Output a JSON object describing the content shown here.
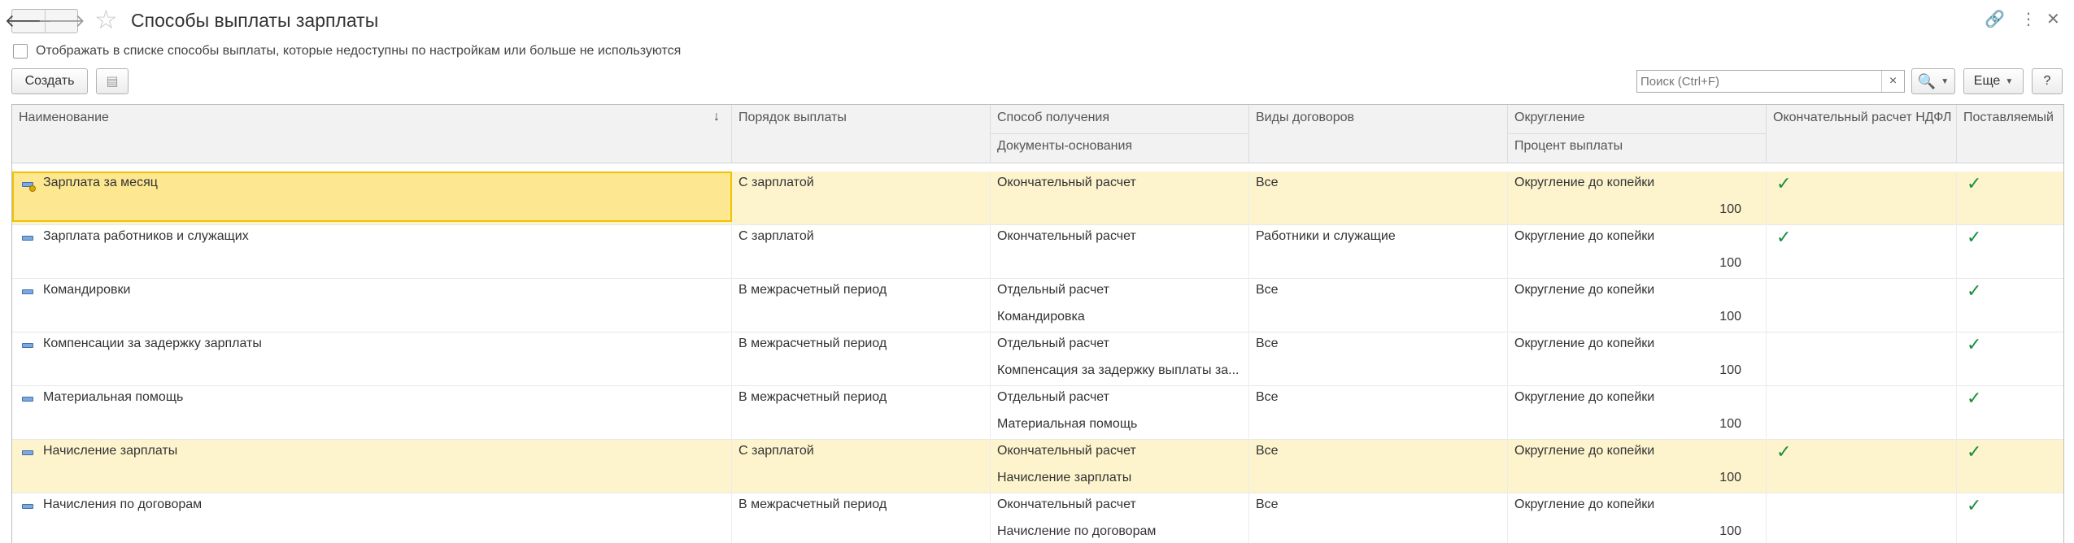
{
  "window": {
    "title": "Способы выплаты зарплаты",
    "back_glyph": "🡐",
    "forward_glyph": "🡒",
    "star_glyph": "☆",
    "link_glyph": "🔗",
    "menu_glyph": "⋮",
    "close_glyph": "✕"
  },
  "filter": {
    "show_unavailable_label": "Отображать в списке способы выплаты, которые недоступны по настройкам или больше не используются",
    "checked": false
  },
  "toolbar": {
    "create_label": "Создать",
    "copy_glyph": "▤",
    "search_placeholder": "Поиск (Ctrl+F)",
    "search_value": "",
    "clear_glyph": "×",
    "search_glyph": "🔍",
    "more_label": "Еще",
    "help_label": "?"
  },
  "columns": {
    "name": "Наименование",
    "payout_order": "Порядок выплаты",
    "method": "Способ получения",
    "base_docs": "Документы-основания",
    "contracts": "Виды договоров",
    "rounding": "Округление",
    "percent": "Процент выплаты",
    "final_ndfl": "Окончательный расчет НДФЛ",
    "supplied": "Поставляемый",
    "sort_glyph": "↓"
  },
  "check_glyph": "✓",
  "rows": [
    {
      "name": "Зарплата за месяц",
      "order": "С зарплатой",
      "method": "Окончательный расчет",
      "docs": "",
      "contracts": "Все",
      "rounding": "Округление до копейки",
      "percent": "100",
      "ndfl": true,
      "supplied": true,
      "highlight": true,
      "selected": true
    },
    {
      "name": "Зарплата работников и служащих",
      "order": "С зарплатой",
      "method": "Окончательный расчет",
      "docs": "",
      "contracts": "Работники и служащие",
      "rounding": "Округление до копейки",
      "percent": "100",
      "ndfl": true,
      "supplied": true,
      "highlight": false,
      "selected": false
    },
    {
      "name": "Командировки",
      "order": "В межрасчетный период",
      "method": "Отдельный расчет",
      "docs": "Командировка",
      "contracts": "Все",
      "rounding": "Округление до копейки",
      "percent": "100",
      "ndfl": false,
      "supplied": true,
      "highlight": false,
      "selected": false
    },
    {
      "name": "Компенсации за задержку зарплаты",
      "order": "В межрасчетный период",
      "method": "Отдельный расчет",
      "docs": "Компенсация за задержку выплаты за...",
      "contracts": "Все",
      "rounding": "Округление до копейки",
      "percent": "100",
      "ndfl": false,
      "supplied": true,
      "highlight": false,
      "selected": false
    },
    {
      "name": "Материальная помощь",
      "order": "В межрасчетный период",
      "method": "Отдельный расчет",
      "docs": "Материальная помощь",
      "contracts": "Все",
      "rounding": "Округление до копейки",
      "percent": "100",
      "ndfl": false,
      "supplied": true,
      "highlight": false,
      "selected": false
    },
    {
      "name": "Начисление зарплаты",
      "order": "С зарплатой",
      "method": "Окончательный расчет",
      "docs": "Начисление зарплаты",
      "contracts": "Все",
      "rounding": "Округление до копейки",
      "percent": "100",
      "ndfl": true,
      "supplied": true,
      "highlight": true,
      "selected": false
    },
    {
      "name": "Начисления по договорам",
      "order": "В межрасчетный период",
      "method": "Окончательный расчет",
      "docs": "Начисление по договорам",
      "contracts": "Все",
      "rounding": "Округление до копейки",
      "percent": "100",
      "ndfl": false,
      "supplied": true,
      "highlight": false,
      "selected": false
    }
  ],
  "colors": {
    "highlight_row": "#fdf4cd",
    "selected_cell": "#fde790",
    "selected_border": "#f0c200",
    "check": "#1b8e3a",
    "accent": "#2a6fd0"
  }
}
